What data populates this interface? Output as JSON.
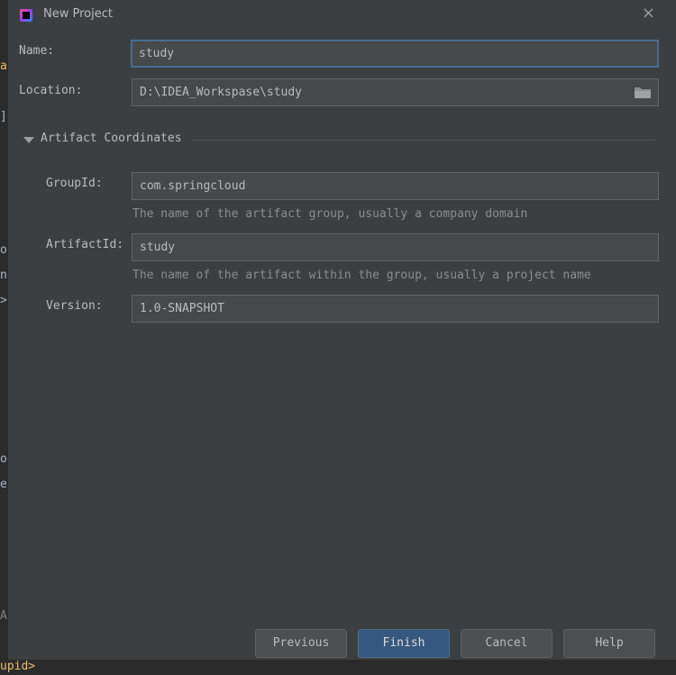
{
  "background_editor": {
    "chars": [
      "a",
      "]",
      "o",
      "n",
      ">",
      "o",
      "e",
      "A"
    ],
    "bottom_text": "upid>"
  },
  "dialog": {
    "title": "New Project",
    "close_glyph": "×"
  },
  "form": {
    "name_label": "Name:",
    "name_value": "study",
    "location_label": "Location:",
    "location_value": "D:\\IDEA_Workspase\\study",
    "section_title": "Artifact Coordinates",
    "groupid_label": "GroupId:",
    "groupid_value": "com.springcloud",
    "groupid_hint": "The name of the artifact group, usually a company domain",
    "artifactid_label": "ArtifactId:",
    "artifactid_value": "study",
    "artifactid_hint": "The name of the artifact within the group, usually a project name",
    "version_label": "Version:",
    "version_value": "1.0-SNAPSHOT"
  },
  "buttons": {
    "previous": "Previous",
    "finish": "Finish",
    "cancel": "Cancel",
    "help": "Help"
  },
  "colors": {
    "dialog_bg": "#3c3f41",
    "field_bg": "#45494a",
    "focus_border": "#466d94",
    "default_button": "#365880"
  }
}
